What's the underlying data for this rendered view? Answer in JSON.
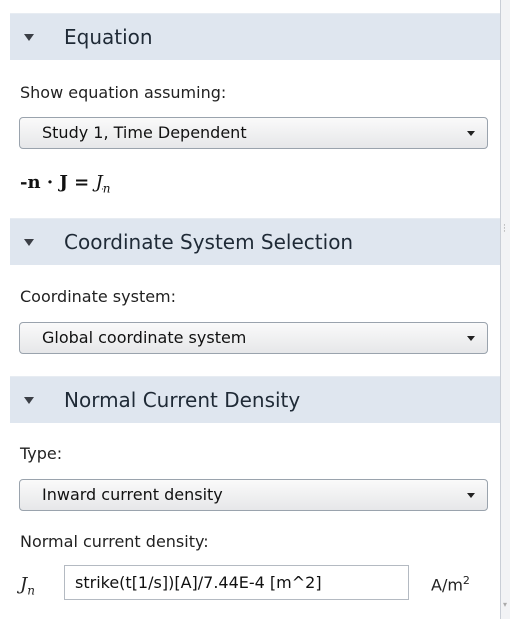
{
  "sections": {
    "equation": {
      "title": "Equation",
      "show_label": "Show equation assuming:",
      "study_value": "Study 1, Time Dependent",
      "eq_lhs": "-n · J = ",
      "eq_rhs_symbol": "J",
      "eq_rhs_sub": "n"
    },
    "coordinate": {
      "title": "Coordinate System Selection",
      "label": "Coordinate system:",
      "value": "Global coordinate system"
    },
    "normal_current": {
      "title": "Normal Current Density",
      "type_label": "Type:",
      "type_value": "Inward current density",
      "density_label": "Normal current density:",
      "symbol": "J",
      "symbol_sub": "n",
      "expression": "strike(t[1/s])[A]/7.44E-4  [m^2]",
      "unit_base": "A/m",
      "unit_exp": "2"
    }
  },
  "icons": {
    "collapse": "triangle-down-icon",
    "dropdown": "chevron-down-icon"
  },
  "colors": {
    "header_bg": "#dfe6ef",
    "panel_bg": "#ffffff"
  }
}
